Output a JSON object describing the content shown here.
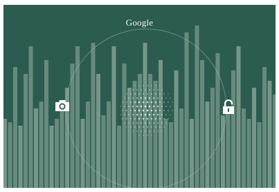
{
  "lockscreen": {
    "search_label": "Google",
    "targets": [
      {
        "name": "camera",
        "icon": "camera-icon"
      },
      {
        "name": "unlock",
        "icon": "unlock-icon"
      }
    ],
    "colors": {
      "background": "#2c5c4f",
      "bar": "#8ea99c",
      "ring": "#9fb8ad",
      "icon": "#ffffff"
    }
  }
}
